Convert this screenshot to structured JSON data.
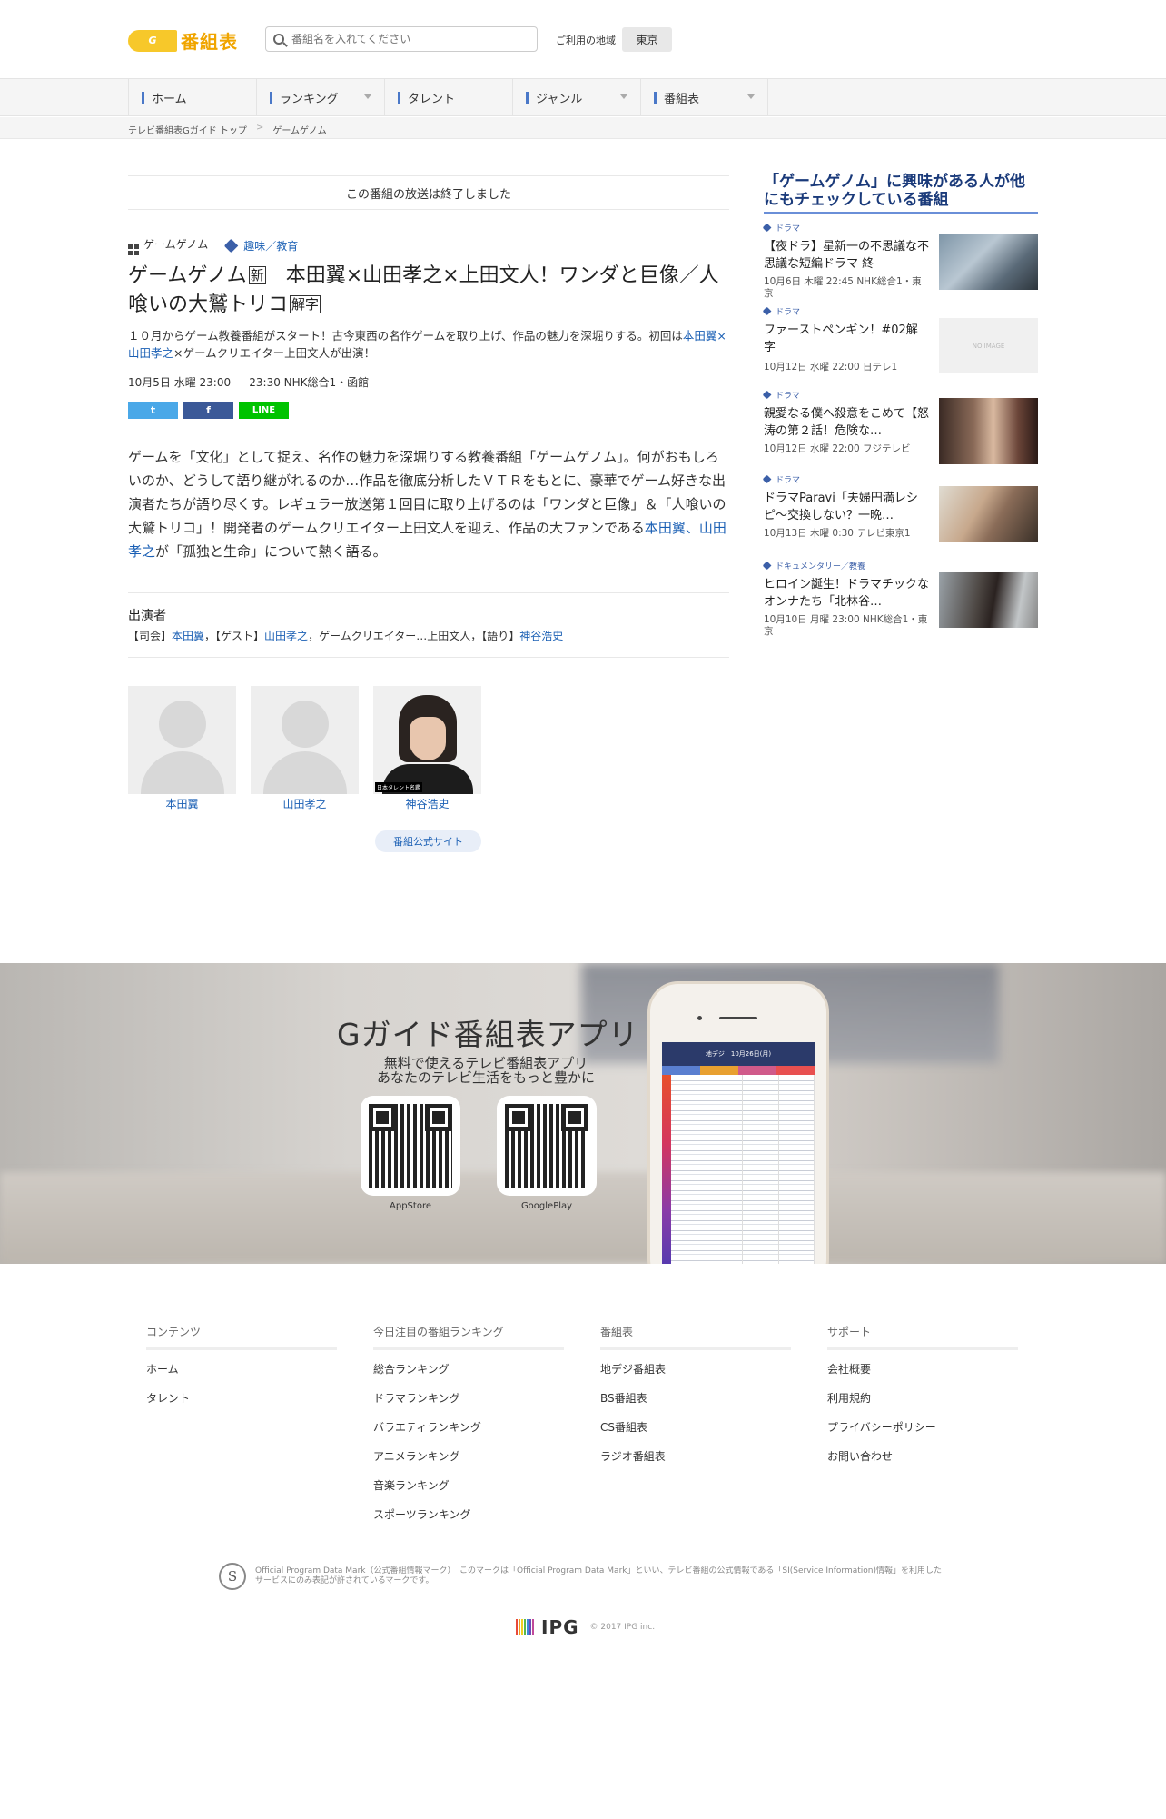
{
  "header": {
    "logo_mark": "G",
    "logo_text": "番組表",
    "search_placeholder": "番組名を入れてください",
    "region_label": "ご利用の地域",
    "region_value": "東京"
  },
  "nav": {
    "items": [
      {
        "label": "ホーム",
        "has_dropdown": false
      },
      {
        "label": "ランキング",
        "has_dropdown": true
      },
      {
        "label": "タレント",
        "has_dropdown": false
      },
      {
        "label": "ジャンル",
        "has_dropdown": true
      },
      {
        "label": "番組表",
        "has_dropdown": true
      }
    ]
  },
  "breadcrumb": {
    "items": [
      "テレビ番組表Gガイド トップ",
      ">",
      "ゲームゲノム"
    ]
  },
  "program": {
    "ended_notice": "この番組の放送は終了しました",
    "series": "ゲームゲノム",
    "genre": "趣味／教育",
    "title_main": "ゲームゲノム",
    "title_badge1": "新",
    "title_rest": "　本田翼×山田孝之×上田文人！ワンダと巨像／人喰いの大鷲トリコ",
    "title_badge2": "解字",
    "subdesc_pre": "１０月からゲーム教養番組がスタート！古今東西の名作ゲームを取り上げ、作品の魅力を深堀りする。初回は",
    "subdesc_link1": "本田翼",
    "subdesc_x": "×",
    "subdesc_link2": "山田孝之",
    "subdesc_post": "×ゲームクリエイター上田文人が出演！",
    "airtime": "10月5日 水曜 23:00　- 23:30 NHK総合1・函館",
    "share": {
      "twitter": "t",
      "facebook": "f",
      "line": "LINE"
    },
    "body_pre": "ゲームを「文化」として捉え、名作の魅力を深堀りする教養番組「ゲームゲノム」。何がおもしろいのか、どうして語り継がれるのか…作品を徹底分析したＶＴＲをもとに、豪華でゲーム好きな出演者たちが語り尽くす。レギュラー放送第１回目に取り上げるのは「ワンダと巨像」＆「人喰いの大鷲トリコ」！開発者のゲームクリエイター上田文人を迎え、作品の大ファンである",
    "body_link1": "本田翼",
    "body_sep": "、",
    "body_link2": "山田孝之",
    "body_post": "が「孤独と生命」について熱く語る。",
    "cast_heading": "出演者",
    "cast_line": {
      "host_label": "【司会】",
      "host": "本田翼",
      "guest_label": "，【ゲスト】",
      "guest": "山田孝之",
      "creator": "，ゲームクリエイター…上田文人，【語り】",
      "narrator": "神谷浩史"
    },
    "cast_cards": [
      {
        "name": "本田翼"
      },
      {
        "name": "山田孝之"
      },
      {
        "name": "神谷浩史",
        "photo_caption": "日本タレント名鑑"
      }
    ],
    "official_site": "番組公式サイト"
  },
  "sidebar": {
    "heading": "「ゲームゲノム」に興味がある人が他にもチェックしている番組",
    "items": [
      {
        "genre": "ドラマ",
        "title": "【夜ドラ】星新一の不思議な不思議な短編ドラマ 終",
        "time": "10月6日 木曜 22:45 NHK総合1・東京",
        "thumb": "photo"
      },
      {
        "genre": "ドラマ",
        "title": "ファーストペンギン！#02解字",
        "time": "10月12日 水曜 22:00 日テレ1",
        "thumb": "noimage",
        "noimage_label": "NO IMAGE"
      },
      {
        "genre": "ドラマ",
        "title": "親愛なる僕へ殺意をこめて【怒涛の第２話！危険な…",
        "time": "10月12日 水曜 22:00 フジテレビ",
        "thumb": "photo"
      },
      {
        "genre": "ドラマ",
        "title": "ドラマParavi「夫婦円満レシピ〜交換しない？一晩…",
        "time": "10月13日 木曜 0:30 テレビ東京1",
        "thumb": "photo"
      },
      {
        "genre": "ドキュメンタリー／教養",
        "title": "ヒロイン誕生！ドラマチックなオンナたち「北林谷…",
        "time": "10月10日 月曜 23:00 NHK総合1・東京",
        "thumb": "photo"
      }
    ]
  },
  "app_promo": {
    "title": "Gガイド番組表アプリ",
    "subtitle": "無料で使えるテレビ番組表アプリ\nあなたのテレビ生活をもっと豊かに",
    "appstore": "AppStore",
    "googleplay": "GooglePlay",
    "phone_header": "地デジ　10月26日(月)"
  },
  "footer": {
    "columns": [
      {
        "heading": "コンテンツ",
        "links": [
          "ホーム",
          "タレント"
        ]
      },
      {
        "heading": "今日注目の番組ランキング",
        "links": [
          "総合ランキング",
          "ドラマランキング",
          "バラエティランキング",
          "アニメランキング",
          "音楽ランキング",
          "スポーツランキング"
        ]
      },
      {
        "heading": "番組表",
        "links": [
          "地デジ番組表",
          "BS番組表",
          "CS番組表",
          "ラジオ番組表"
        ]
      },
      {
        "heading": "サポート",
        "links": [
          "会社概要",
          "利用規約",
          "プライバシーポリシー",
          "お問い合わせ"
        ]
      }
    ],
    "odm_mark": "S",
    "odm_text": "Official Program Data Mark（公式番組情報マーク）　このマークは「Official Program Data Mark」といい、テレビ番組の公式情報である「SI(Service Information)情報」を利用したサービスにのみ表記が許されているマークです。",
    "ipg_name": "IPG",
    "copyright": "© 2017 IPG inc."
  },
  "colors": {
    "logo": "#f0a500",
    "link": "#1a5fb4",
    "nav_accent": "#4a78c8",
    "sidebar_heading": "#1a3a7a",
    "twitter": "#4aa8e8",
    "facebook": "#3b5998",
    "line": "#00c300"
  }
}
